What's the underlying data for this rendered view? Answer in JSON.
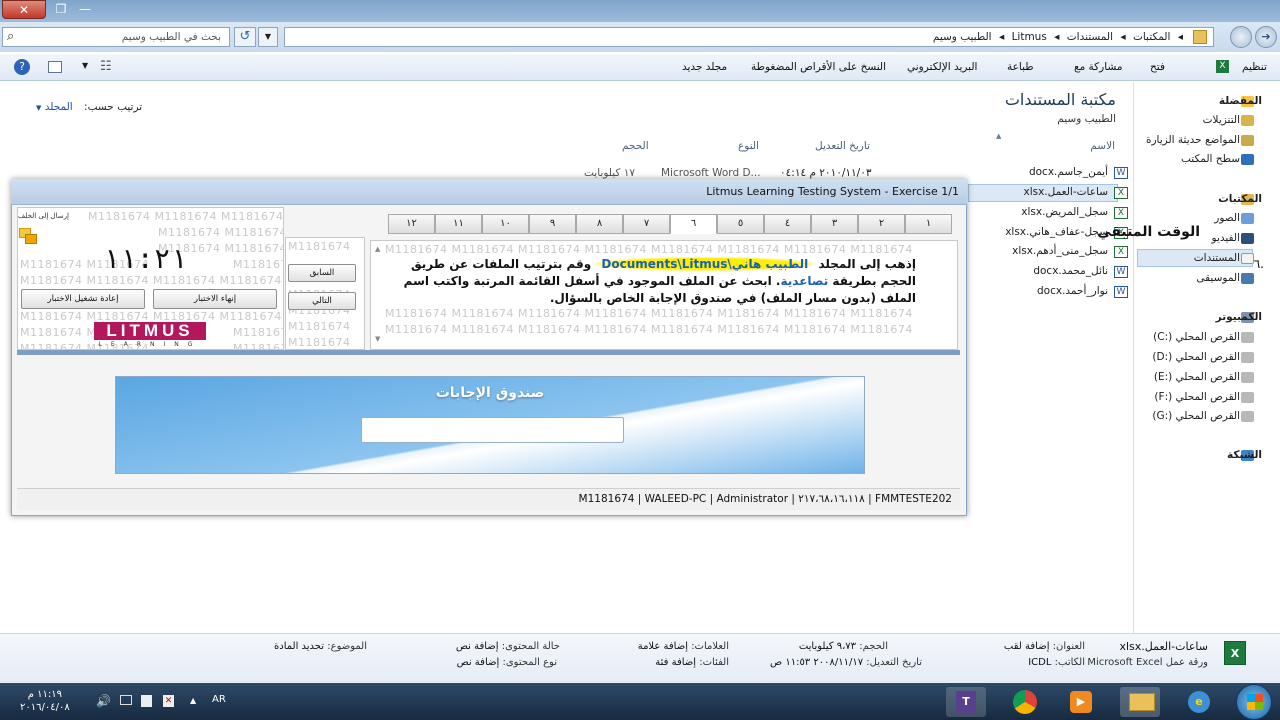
{
  "titlebar": {
    "close": "✕",
    "restore": "❐",
    "minimize": "—"
  },
  "address": {
    "crumbs": [
      "المكتبات",
      "المستندات",
      "Litmus",
      "الطبيب وسيم"
    ],
    "separator": "◂",
    "search_placeholder": "بحث في الطبيب وسيم"
  },
  "toolbar": {
    "organize": "تنظيم",
    "open": "فتح",
    "share": "مشاركة مع",
    "print": "طباعة",
    "email": "البريد الإلكتروني",
    "burn": "النسخ على الأقراص المضغوطة",
    "new_folder": "مجلد جديد"
  },
  "nav": {
    "favorites": "المفضلة",
    "downloads": "التنزيلات",
    "recent": "المواضع حديثة الزيارة",
    "desktop": "سطح المكتب",
    "libraries": "المكتبات",
    "pictures": "الصور",
    "videos": "الفيديو",
    "documents": "المستندات",
    "music": "الموسيقى",
    "computer": "الكمبيوتر",
    "drives": [
      "القرص المحلي (:C)",
      "القرص المحلي (:D)",
      "القرص المحلي (:E)",
      "القرص المحلي (:F)",
      "القرص المحلي (:G)"
    ],
    "network": "الشبكة"
  },
  "library": {
    "title": "مكتبة المستندات",
    "subtitle": "الطبيب وسيم",
    "arrange_label": "ترتيب حسب:",
    "arrange_value": "المجلد"
  },
  "columns": {
    "name": "الاسم",
    "modified": "تاريخ التعديل",
    "type": "النوع",
    "size": "الحجم"
  },
  "first_row": {
    "modified": "٢٠١٠/١١/٠٣ م ٠٤:١٤",
    "type": "Microsoft Word D...",
    "size": "١٧ كيلوبايت"
  },
  "files": [
    "أيمن_جاسم.docx",
    "ساعات-العمل.xlsx",
    "سجل_المريض.xlsx",
    "سجل-عفاف_هاني.xlsx",
    "سجل_منى_أدهم.xlsx",
    "نائل_محمد.docx",
    "نوار_أحمد.docx"
  ],
  "exam": {
    "title": "Litmus Learning Testing System - Exercise 1/1",
    "watermark": "M1181674",
    "remaining_label": "الوقت المتبقي",
    "timer": "١١:٢١",
    "send_label": "إرسال إلى الخلف",
    "end_button": "إنهاء الاختبار",
    "restart_button": "إعادة تشغيل الاختبار",
    "prev_button": "السابق",
    "next_button": "التالي",
    "logo_text": "LITMUS",
    "logo_sub": "LEARNING",
    "tabs": [
      "١",
      "٢",
      "٣",
      "٤",
      "٥",
      "٦",
      "٧",
      "٨",
      "٩",
      "١٠",
      "١١",
      "١٢"
    ],
    "active_tab": 5,
    "question_number": "٦.",
    "question_part1": "إذهب إلى المجلد ",
    "question_path": "الطبيب هاني\\Documents\\Litmus",
    "question_part2": " وقم بترتيب الملفات عن طريق الحجم بطريقة ",
    "question_part3": "تصاعدية",
    "question_part4": ". ابحث عن الملف الموجود في أسفل القائمة المرتبة واكتب اسم الملف (بدون مسار الملف) في صندوق الإجابة الخاص بالسؤال.",
    "answer_label": "صندوق الإجابات",
    "status": "M1181674  |  WALEED-PC  |  Administrator  |  ٢١٧،٦٨،١٦،١١٨  |  FMMTESTE202"
  },
  "details": {
    "filename": "ساعات-العمل.xlsx",
    "filetype": "ورقة عمل Microsoft Excel",
    "title_label": "العنوان:",
    "title_value": "إضافة لقب",
    "author_label": "الكاتب:",
    "author_value": "ICDL",
    "size_label": "الحجم:",
    "size_value": "٩،٧٣ كيلوبايت",
    "modified_label": "تاريخ التعديل:",
    "modified_value": "٢٠٠٨/١١/١٧ ١١:٥٣ ص",
    "tags_label": "العلامات:",
    "tags_value": "إضافة علامة",
    "categories_label": "الفئات:",
    "categories_value": "إضافة فئة",
    "content_status_label": "حالة المحتوى:",
    "content_status_value": "إضافة نص",
    "content_type_label": "نوع المحتوى:",
    "content_type_value": "إضافة نص",
    "subject_label": "الموضوع:",
    "subject_value": "تحديد المادة"
  },
  "taskbar": {
    "time": "١١:١٩ م",
    "date": "٢٠١٦/٠٤/٠٨",
    "lang": "AR"
  }
}
